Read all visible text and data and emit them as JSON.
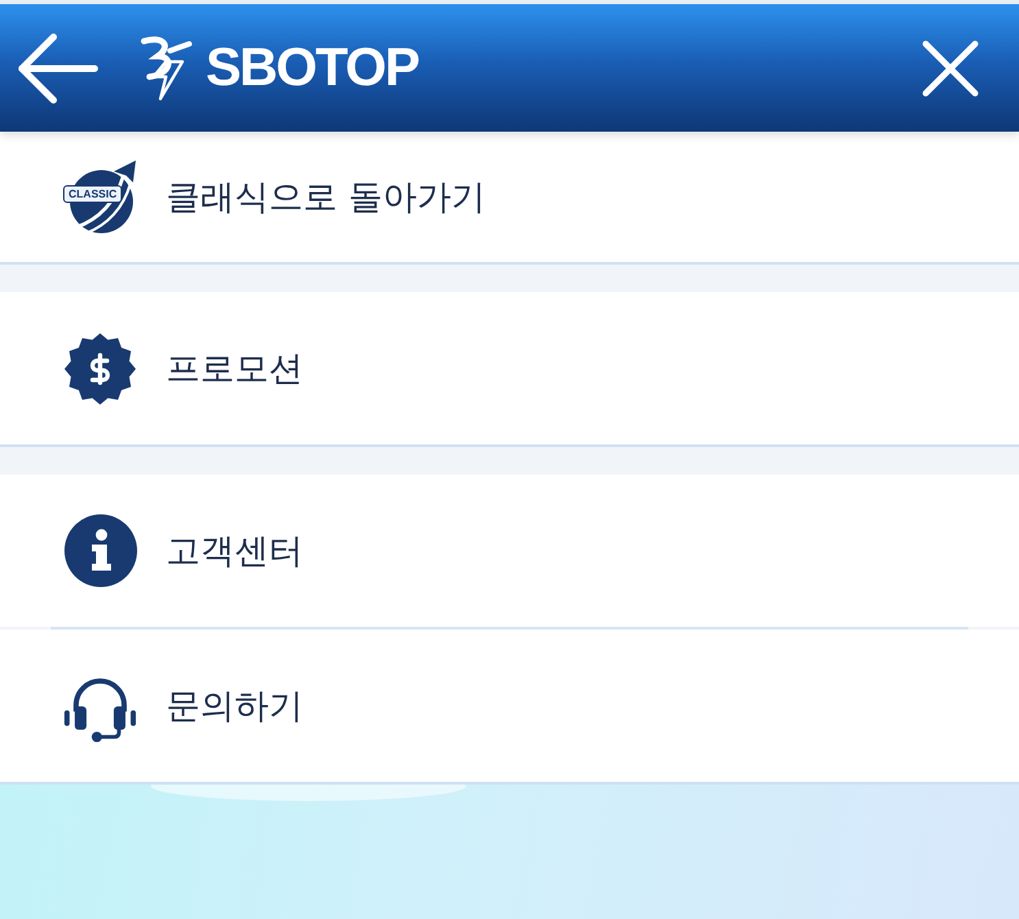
{
  "header": {
    "title": "SBOTOP"
  },
  "menu_groups": [
    {
      "items": [
        {
          "kind": "classic",
          "badge": "CLASSIC",
          "label": "클래식으로 돌아가기"
        }
      ]
    },
    {
      "items": [
        {
          "kind": "promotion",
          "label": "프로모션"
        }
      ]
    },
    {
      "items": [
        {
          "kind": "info",
          "label": "고객센터"
        },
        {
          "kind": "headset",
          "label": "문의하기"
        }
      ]
    }
  ]
}
